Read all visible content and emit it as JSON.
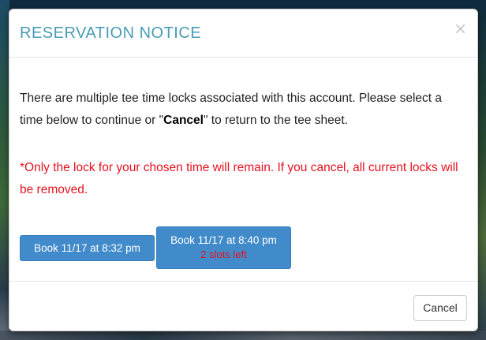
{
  "modal": {
    "title": "RESERVATION NOTICE",
    "close_glyph": "×",
    "message_before": "There are multiple tee time locks associated with this account. Please select a time below to continue or \"",
    "message_bold": "Cancel",
    "message_after": "\" to return to the tee sheet.",
    "warning": "*Only the lock for your chosen time will remain. If you cancel, all current locks will be removed.",
    "buttons": [
      {
        "label": "Book 11/17 at 8:32 pm"
      },
      {
        "label": "Book 11/17 at 8:40 pm",
        "note": "2 slots left"
      }
    ],
    "cancel_label": "Cancel"
  },
  "colors": {
    "title": "#4a9bb5",
    "primary": "#428bca",
    "warning": "#e5121f"
  },
  "icons": {
    "close": "close-icon"
  }
}
